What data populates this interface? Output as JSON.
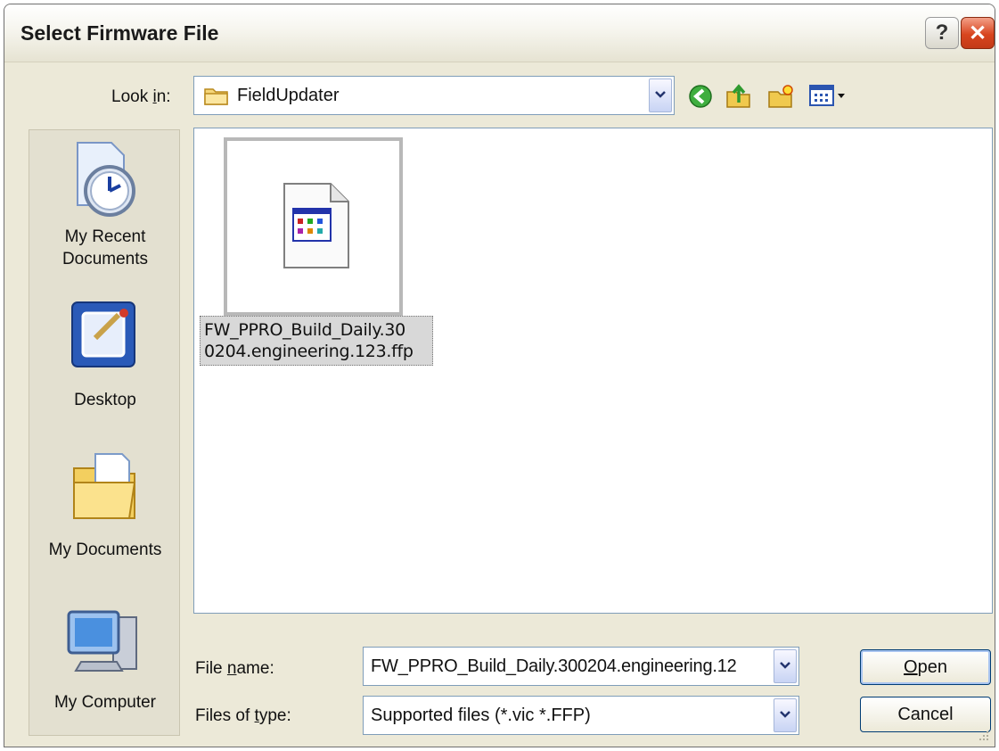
{
  "window": {
    "title": "Select Firmware File",
    "help_label": "?",
    "close_label": "✕"
  },
  "look_in": {
    "label_prefix": "Look ",
    "label_accel": "i",
    "label_suffix": "n:",
    "value": "FieldUpdater"
  },
  "toolbar": {
    "icons": [
      "back-icon",
      "up-folder-icon",
      "new-folder-icon",
      "view-menu-icon"
    ]
  },
  "places": [
    {
      "label_line1": "My Recent",
      "label_line2": "Documents",
      "icon": "recent-documents-icon"
    },
    {
      "label_line1": "Desktop",
      "label_line2": "",
      "icon": "desktop-icon"
    },
    {
      "label_line1": "My Documents",
      "label_line2": "",
      "icon": "my-documents-icon"
    },
    {
      "label_line1": "My Computer",
      "label_line2": "",
      "icon": "my-computer-icon"
    }
  ],
  "files": [
    {
      "name": "FW_PPRO_Build_Daily.30\n0204.engineering.123.ffp",
      "selected": true
    }
  ],
  "file_name": {
    "label_prefix": "File ",
    "label_accel": "n",
    "label_suffix": "ame:",
    "value": "FW_PPRO_Build_Daily.300204.engineering.12"
  },
  "file_type": {
    "label_prefix": "Files of ",
    "label_accel": "t",
    "label_suffix": "ype:",
    "value": "Supported files (*.vic *.FFP)"
  },
  "buttons": {
    "open_accel": "O",
    "open_rest": "pen",
    "cancel": "Cancel"
  },
  "colors": {
    "dialog_bg": "#ece9d8",
    "close_red": "#d8451f",
    "selection_bg": "#d8d8d8"
  }
}
